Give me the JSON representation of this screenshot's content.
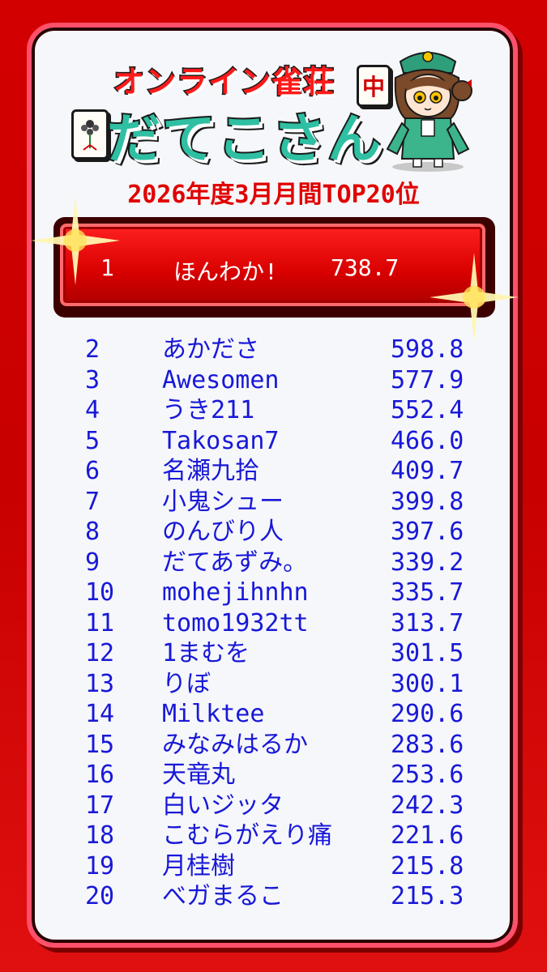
{
  "header": {
    "logo_line1": "オンライン雀荘",
    "logo_line2": "だてこさん",
    "tile_chun": "中",
    "subtitle": "2026年度3月月間TOP20位"
  },
  "first_place": {
    "rank": "1",
    "name": "ほんわか!",
    "score": "738.7"
  },
  "rankings": [
    {
      "rank": "2",
      "name": "あかださ",
      "score": "598.8"
    },
    {
      "rank": "3",
      "name": "Awesomen",
      "score": "577.9"
    },
    {
      "rank": "4",
      "name": "うき211",
      "score": "552.4"
    },
    {
      "rank": "5",
      "name": "Takosan7",
      "score": "466.0"
    },
    {
      "rank": "6",
      "name": "名瀬九拾",
      "score": "409.7"
    },
    {
      "rank": "7",
      "name": "小鬼シュー",
      "score": "399.8"
    },
    {
      "rank": "8",
      "name": "のんびり人",
      "score": "397.6"
    },
    {
      "rank": "9",
      "name": "だてあずみ。",
      "score": "339.2"
    },
    {
      "rank": "10",
      "name": "mohejihnhn",
      "score": "335.7"
    },
    {
      "rank": "11",
      "name": "tomo1932tt",
      "score": "313.7"
    },
    {
      "rank": "12",
      "name": "1まむを",
      "score": "301.5"
    },
    {
      "rank": "13",
      "name": "りぼ",
      "score": "300.1"
    },
    {
      "rank": "14",
      "name": "Milktee",
      "score": "290.6"
    },
    {
      "rank": "15",
      "name": "みなみはるか",
      "score": "283.6"
    },
    {
      "rank": "16",
      "name": "天竜丸",
      "score": "253.6"
    },
    {
      "rank": "17",
      "name": "白いジッタ",
      "score": "242.3"
    },
    {
      "rank": "18",
      "name": "こむらがえり痛",
      "score": "221.6"
    },
    {
      "rank": "19",
      "name": "月桂樹",
      "score": "215.8"
    },
    {
      "rank": "20",
      "name": "べガまるこ",
      "score": "215.3"
    }
  ],
  "icons": [
    "chun-tile-icon",
    "flower-tile-icon",
    "mascot-character",
    "sparkle-icon"
  ],
  "colors": {
    "background": "#d30000",
    "card": "#f6f7fa",
    "accent_green": "#2fbfa2",
    "rank_text": "#1818d8",
    "first_box": "#e00000"
  }
}
